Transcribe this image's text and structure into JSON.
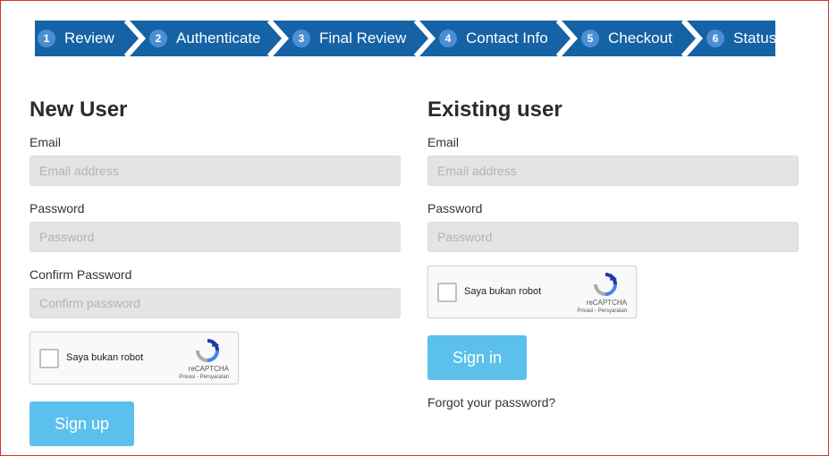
{
  "steps": [
    {
      "num": "1",
      "label": "Review"
    },
    {
      "num": "2",
      "label": "Authenticate"
    },
    {
      "num": "3",
      "label": "Final Review"
    },
    {
      "num": "4",
      "label": "Contact Info"
    },
    {
      "num": "5",
      "label": "Checkout"
    },
    {
      "num": "6",
      "label": "Status"
    }
  ],
  "new_user": {
    "heading": "New User",
    "email_label": "Email",
    "email_placeholder": "Email address",
    "password_label": "Password",
    "password_placeholder": "Password",
    "confirm_label": "Confirm Password",
    "confirm_placeholder": "Confirm password",
    "captcha": {
      "text": "Saya bukan robot",
      "brand": "reCAPTCHA",
      "legal": "Privasi - Persyaratan"
    },
    "submit_label": "Sign up"
  },
  "existing_user": {
    "heading": "Existing user",
    "email_label": "Email",
    "email_placeholder": "Email address",
    "password_label": "Password",
    "password_placeholder": "Password",
    "captcha": {
      "text": "Saya bukan robot",
      "brand": "reCAPTCHA",
      "legal": "Privasi - Persyaratan"
    },
    "submit_label": "Sign in",
    "forgot_label": "Forgot your password?"
  },
  "colors": {
    "steps_bg": "#1562a5",
    "step_number_bg": "#4a8fd4",
    "button_bg": "#5bc0eb",
    "input_bg": "#e4e4e4",
    "frame_border": "#d32f2f"
  }
}
